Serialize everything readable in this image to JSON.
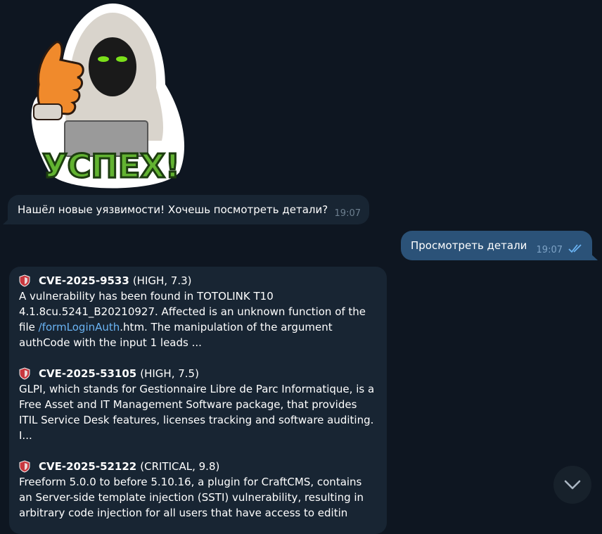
{
  "sticker": {
    "caption": "УСПЕХ!",
    "icon": "hacker-thumbs-up-sticker"
  },
  "messages": {
    "m1": {
      "text": "Нашёл новые уязвимости! Хочешь посмотреть детали?",
      "time": "19:07"
    },
    "m2": {
      "text": "Просмотреть детали",
      "time": "19:07",
      "status": "read-double-check"
    },
    "m3": {
      "cves": [
        {
          "id": "CVE-2025-9533",
          "severity": "(HIGH, 7.3)",
          "text_before_link": "A vulnerability has been found in TOTOLINK T10 4.1.8cu.5241_B20210927. Affected is an unknown function of the file ",
          "link": "/formLoginAuth",
          "text_after_link": ".htm. The manipulation of the argument authCode with the input 1 leads ..."
        },
        {
          "id": "CVE-2025-53105",
          "severity": "(HIGH, 7.5)",
          "text": "GLPI, which stands for Gestionnaire Libre de Parc Informatique, is a Free Asset and IT Management Software package, that provides ITIL Service Desk features, licenses tracking and software auditing. I..."
        },
        {
          "id": "CVE-2025-52122",
          "severity": "(CRITICAL, 9.8)",
          "text": "Freeform 5.0.0 to before 5.10.16, a plugin for CraftCMS, contains an Server-side template injection (SSTI) vulnerability, resulting in arbitrary code injection for all users that have access to editin"
        }
      ]
    }
  },
  "colors": {
    "background": "#0e1621",
    "incoming_bubble": "#182533",
    "outgoing_bubble": "#2b5278",
    "link": "#6ab3f3",
    "shield_red": "#c8373e"
  },
  "icons": {
    "shield": "shield-icon",
    "scroll": "chevron-down-icon"
  }
}
